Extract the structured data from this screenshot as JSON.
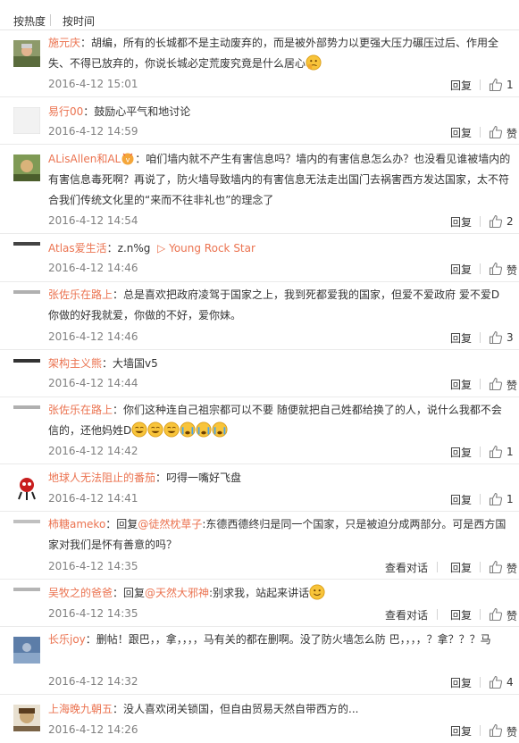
{
  "sort": {
    "hot": "按热度",
    "time": "按时间"
  },
  "actions": {
    "reply": "回复",
    "view_thread": "查看对话",
    "like_zero": "赞"
  },
  "comments": [
    {
      "user": "施元庆",
      "text": "：胡编，所有的长城都不是主动废弃的，而是被外部势力以更强大压力碾压过后、作用全失、不得已放弃的，你说长城必定荒废究竟是什么居心",
      "time": "2016-4-12 15:01",
      "likes": "1"
    },
    {
      "user": "易行00",
      "text": "：鼓励心平气和地讨论",
      "time": "2016-4-12 14:59",
      "likes": "赞"
    },
    {
      "user": "ALisAllen和AL",
      "text": "：咱们墙内就不产生有害信息吗？墙内的有害信息怎么办？也没看见谁被墙内的有害信息毒死啊？再说了，防火墙导致墙内的有害信息无法走出国门去祸害西方发达国家，太不符合我们传统文化里的“来而不往非礼也”的理念了",
      "time": "2016-4-12 14:54",
      "likes": "2"
    },
    {
      "user": "Atlas爱生活",
      "text": "：z.n%g",
      "link": "▷ Young Rock Star",
      "time": "2016-4-12 14:46",
      "likes": "赞"
    },
    {
      "user": "张佐乐在路上",
      "text": "：总是喜欢把政府凌驾于国家之上，我到死都爱我的国家，但爱不爱政府 爱不爱D 你做的好我就爱，你做的不好，爱你妹。",
      "time": "2016-4-12 14:46",
      "likes": "3"
    },
    {
      "user": "架构主义熊",
      "text": "：大墙国v5",
      "time": "2016-4-12 14:44",
      "likes": "赞"
    },
    {
      "user": "张佐乐在路上",
      "text": "：你们这种连自己祖宗都可以不要 随便就把自己姓都给换了的人，说什么我都不会信的，还他妈姓D",
      "time": "2016-4-12 14:42",
      "likes": "1"
    },
    {
      "user": "地球人无法阻止的番茄",
      "text": "：叼得一嘴好飞盘",
      "time": "2016-4-12 14:41",
      "likes": "1"
    },
    {
      "user": "柿糖ameko",
      "text_pre": "：回复",
      "mention": "@徒然枕草子",
      "text": ":东德西德终归是同一个国家，只是被迫分成两部分。可是西方国家对我们是怀有善意的吗？",
      "time": "2016-4-12 14:35",
      "likes": "赞"
    },
    {
      "user": "吴牧之的爸爸",
      "text_pre": "：回复",
      "mention": "@天然大邪神",
      "text": ":别求我，站起来讲话",
      "time": "2016-4-12 14:35",
      "likes": "赞"
    },
    {
      "user": "长乐joy",
      "text": "：删帖！跟巴，，拿，，，，马有关的都在删啊。没了防火墙怎么防 巴，，，，？拿？？？马",
      "time": "2016-4-12 14:32",
      "likes": "4"
    },
    {
      "user": "上海晚九朝五",
      "text": "：没人喜欢闭关锁国，但自由贸易天然自带西方的...",
      "time": "2016-4-12 14:26",
      "likes": "赞"
    }
  ]
}
